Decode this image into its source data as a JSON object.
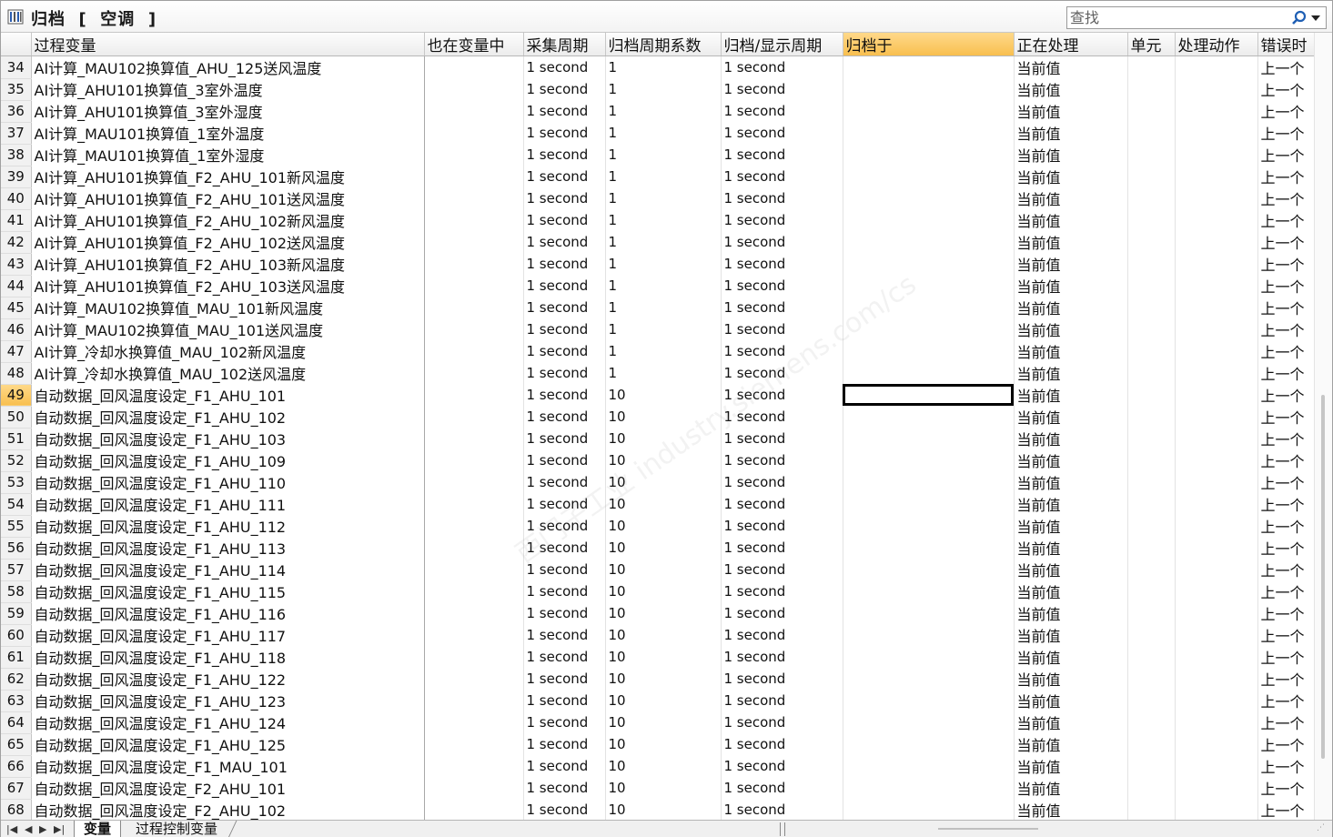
{
  "window": {
    "title": "归档  [  空调  ]"
  },
  "search": {
    "placeholder": "查找"
  },
  "columns": [
    "过程变量",
    "也在变量中",
    "采集周期",
    "归档周期系数",
    "归档/显示周期",
    "归档于",
    "正在处理",
    "单元",
    "处理动作",
    "错误时"
  ],
  "selected_row": "49",
  "rows": [
    [
      "34",
      "AI计算_MAU102换算值_AHU_125送风温度",
      "",
      "1 second",
      "1",
      "1 second",
      "",
      "当前值",
      "",
      "",
      "上一个"
    ],
    [
      "35",
      "AI计算_AHU101换算值_3室外温度",
      "",
      "1 second",
      "1",
      "1 second",
      "",
      "当前值",
      "",
      "",
      "上一个"
    ],
    [
      "36",
      "AI计算_AHU101换算值_3室外湿度",
      "",
      "1 second",
      "1",
      "1 second",
      "",
      "当前值",
      "",
      "",
      "上一个"
    ],
    [
      "37",
      "AI计算_MAU101换算值_1室外温度",
      "",
      "1 second",
      "1",
      "1 second",
      "",
      "当前值",
      "",
      "",
      "上一个"
    ],
    [
      "38",
      "AI计算_MAU101换算值_1室外湿度",
      "",
      "1 second",
      "1",
      "1 second",
      "",
      "当前值",
      "",
      "",
      "上一个"
    ],
    [
      "39",
      "AI计算_AHU101换算值_F2_AHU_101新风温度",
      "",
      "1 second",
      "1",
      "1 second",
      "",
      "当前值",
      "",
      "",
      "上一个"
    ],
    [
      "40",
      "AI计算_AHU101换算值_F2_AHU_101送风温度",
      "",
      "1 second",
      "1",
      "1 second",
      "",
      "当前值",
      "",
      "",
      "上一个"
    ],
    [
      "41",
      "AI计算_AHU101换算值_F2_AHU_102新风温度",
      "",
      "1 second",
      "1",
      "1 second",
      "",
      "当前值",
      "",
      "",
      "上一个"
    ],
    [
      "42",
      "AI计算_AHU101换算值_F2_AHU_102送风温度",
      "",
      "1 second",
      "1",
      "1 second",
      "",
      "当前值",
      "",
      "",
      "上一个"
    ],
    [
      "43",
      "AI计算_AHU101换算值_F2_AHU_103新风温度",
      "",
      "1 second",
      "1",
      "1 second",
      "",
      "当前值",
      "",
      "",
      "上一个"
    ],
    [
      "44",
      "AI计算_AHU101换算值_F2_AHU_103送风温度",
      "",
      "1 second",
      "1",
      "1 second",
      "",
      "当前值",
      "",
      "",
      "上一个"
    ],
    [
      "45",
      "AI计算_MAU102换算值_MAU_101新风温度",
      "",
      "1 second",
      "1",
      "1 second",
      "",
      "当前值",
      "",
      "",
      "上一个"
    ],
    [
      "46",
      "AI计算_MAU102换算值_MAU_101送风温度",
      "",
      "1 second",
      "1",
      "1 second",
      "",
      "当前值",
      "",
      "",
      "上一个"
    ],
    [
      "47",
      "AI计算_冷却水换算值_MAU_102新风温度",
      "",
      "1 second",
      "1",
      "1 second",
      "",
      "当前值",
      "",
      "",
      "上一个"
    ],
    [
      "48",
      "AI计算_冷却水换算值_MAU_102送风温度",
      "",
      "1 second",
      "1",
      "1 second",
      "",
      "当前值",
      "",
      "",
      "上一个"
    ],
    [
      "49",
      "自动数据_回风温度设定_F1_AHU_101",
      "",
      "1 second",
      "10",
      "1 second",
      "",
      "当前值",
      "",
      "",
      "上一个"
    ],
    [
      "50",
      "自动数据_回风温度设定_F1_AHU_102",
      "",
      "1 second",
      "10",
      "1 second",
      "",
      "当前值",
      "",
      "",
      "上一个"
    ],
    [
      "51",
      "自动数据_回风温度设定_F1_AHU_103",
      "",
      "1 second",
      "10",
      "1 second",
      "",
      "当前值",
      "",
      "",
      "上一个"
    ],
    [
      "52",
      "自动数据_回风温度设定_F1_AHU_109",
      "",
      "1 second",
      "10",
      "1 second",
      "",
      "当前值",
      "",
      "",
      "上一个"
    ],
    [
      "53",
      "自动数据_回风温度设定_F1_AHU_110",
      "",
      "1 second",
      "10",
      "1 second",
      "",
      "当前值",
      "",
      "",
      "上一个"
    ],
    [
      "54",
      "自动数据_回风温度设定_F1_AHU_111",
      "",
      "1 second",
      "10",
      "1 second",
      "",
      "当前值",
      "",
      "",
      "上一个"
    ],
    [
      "55",
      "自动数据_回风温度设定_F1_AHU_112",
      "",
      "1 second",
      "10",
      "1 second",
      "",
      "当前值",
      "",
      "",
      "上一个"
    ],
    [
      "56",
      "自动数据_回风温度设定_F1_AHU_113",
      "",
      "1 second",
      "10",
      "1 second",
      "",
      "当前值",
      "",
      "",
      "上一个"
    ],
    [
      "57",
      "自动数据_回风温度设定_F1_AHU_114",
      "",
      "1 second",
      "10",
      "1 second",
      "",
      "当前值",
      "",
      "",
      "上一个"
    ],
    [
      "58",
      "自动数据_回风温度设定_F1_AHU_115",
      "",
      "1 second",
      "10",
      "1 second",
      "",
      "当前值",
      "",
      "",
      "上一个"
    ],
    [
      "59",
      "自动数据_回风温度设定_F1_AHU_116",
      "",
      "1 second",
      "10",
      "1 second",
      "",
      "当前值",
      "",
      "",
      "上一个"
    ],
    [
      "60",
      "自动数据_回风温度设定_F1_AHU_117",
      "",
      "1 second",
      "10",
      "1 second",
      "",
      "当前值",
      "",
      "",
      "上一个"
    ],
    [
      "61",
      "自动数据_回风温度设定_F1_AHU_118",
      "",
      "1 second",
      "10",
      "1 second",
      "",
      "当前值",
      "",
      "",
      "上一个"
    ],
    [
      "62",
      "自动数据_回风温度设定_F1_AHU_122",
      "",
      "1 second",
      "10",
      "1 second",
      "",
      "当前值",
      "",
      "",
      "上一个"
    ],
    [
      "63",
      "自动数据_回风温度设定_F1_AHU_123",
      "",
      "1 second",
      "10",
      "1 second",
      "",
      "当前值",
      "",
      "",
      "上一个"
    ],
    [
      "64",
      "自动数据_回风温度设定_F1_AHU_124",
      "",
      "1 second",
      "10",
      "1 second",
      "",
      "当前值",
      "",
      "",
      "上一个"
    ],
    [
      "65",
      "自动数据_回风温度设定_F1_AHU_125",
      "",
      "1 second",
      "10",
      "1 second",
      "",
      "当前值",
      "",
      "",
      "上一个"
    ],
    [
      "66",
      "自动数据_回风温度设定_F1_MAU_101",
      "",
      "1 second",
      "10",
      "1 second",
      "",
      "当前值",
      "",
      "",
      "上一个"
    ],
    [
      "67",
      "自动数据_回风温度设定_F2_AHU_101",
      "",
      "1 second",
      "10",
      "1 second",
      "",
      "当前值",
      "",
      "",
      "上一个"
    ],
    [
      "68",
      "自动数据_回风温度设定_F2_AHU_102",
      "",
      "1 second",
      "10",
      "1 second",
      "",
      "当前值",
      "",
      "",
      "上一个"
    ]
  ],
  "tabs": [
    "变量",
    "过程控制变量"
  ],
  "colors": {
    "header_highlight": "#f8bf4f",
    "selection_border": "#000000"
  }
}
